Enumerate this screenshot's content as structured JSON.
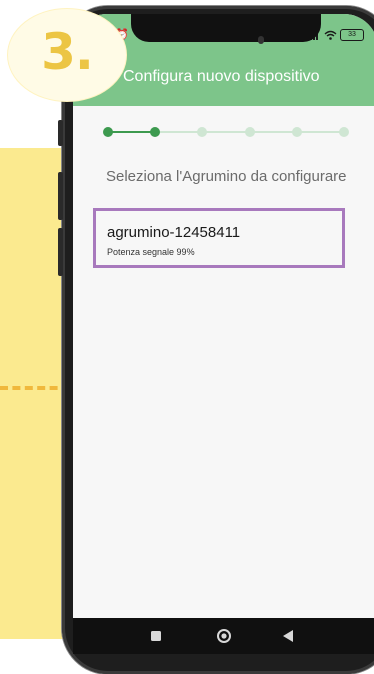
{
  "step_badge": {
    "number": "3."
  },
  "status_bar": {
    "left_icons": "✂ ⏰",
    "battery": "33"
  },
  "app_bar": {
    "title": "Configura nuovo dispositivo"
  },
  "stepper": {
    "total_steps": 6,
    "current_step": 2
  },
  "content": {
    "subtitle": "Seleziona l'Agrumino da configurare",
    "devices": [
      {
        "name": "agrumino-12458411",
        "signal": "Potenza segnale 99%"
      }
    ]
  },
  "colors": {
    "app_bar": "#7dc58a",
    "accent_green": "#3d9a4f",
    "inactive_step": "#cfe6d3",
    "card_border": "#a879bd",
    "badge_number": "#ecc544",
    "yellow_panel": "#fbea8f"
  },
  "nav_bar": {
    "icons": [
      "recent-apps-icon",
      "home-icon",
      "back-icon"
    ]
  }
}
